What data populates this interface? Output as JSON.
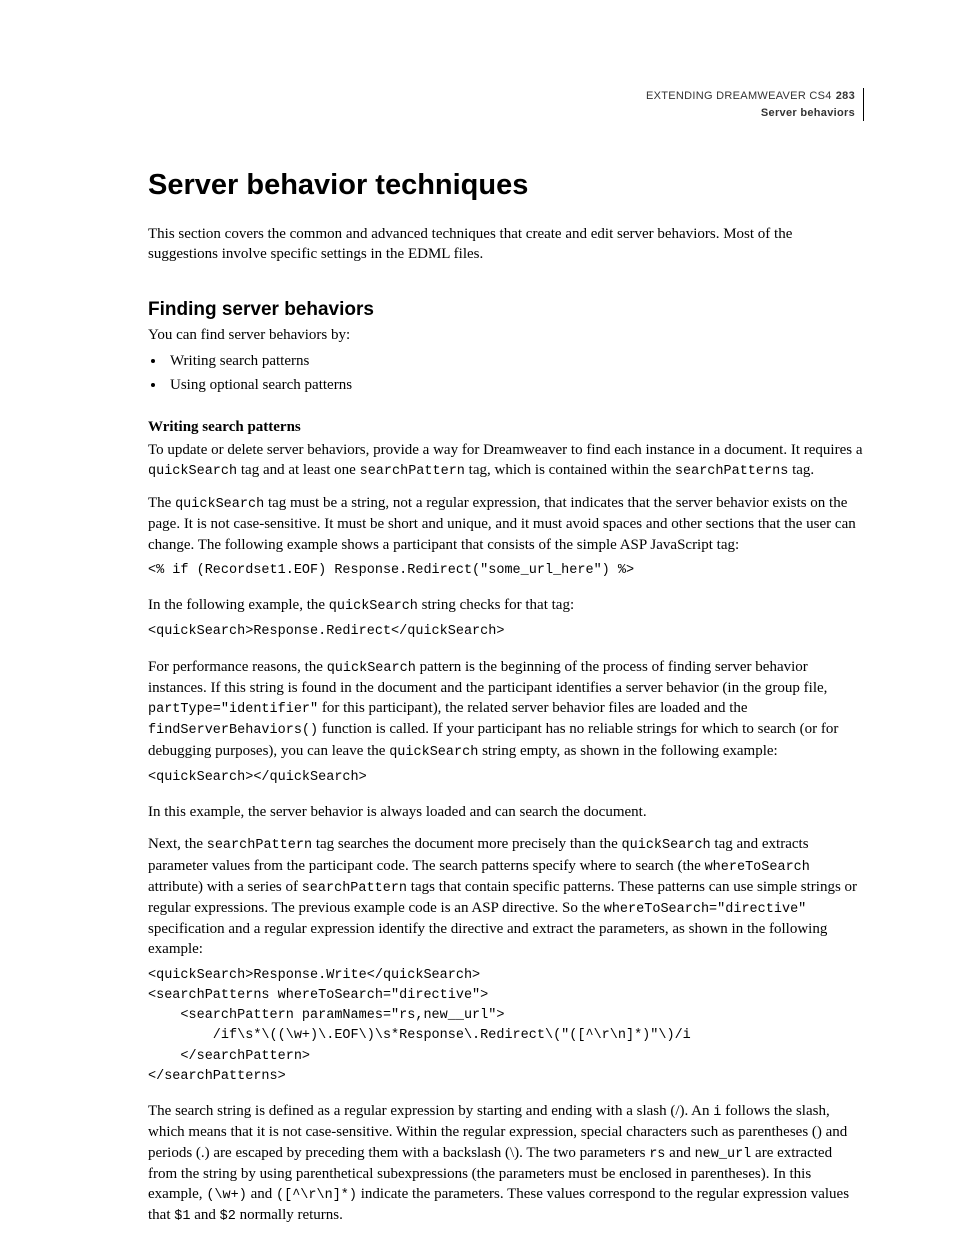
{
  "header": {
    "book": "EXTENDING DREAMWEAVER CS4",
    "page_number": "283",
    "section": "Server behaviors"
  },
  "h1": "Server behavior techniques",
  "intro": "This section covers the common and advanced techniques that create and edit server behaviors. Most of the suggestions involve specific settings in the EDML files.",
  "h2": "Finding server behaviors",
  "p_find_intro": "You can find server behaviors by:",
  "bullets": {
    "b1": "Writing search patterns",
    "b2": "Using optional search patterns"
  },
  "h3": "Writing search patterns",
  "p1a": "To update or delete server behaviors, provide a way for Dreamweaver to find each instance in a document. It requires a ",
  "c1a": "quickSearch",
  "p1b": " tag and at least one ",
  "c1b": "searchPattern",
  "p1c": " tag, which is contained within the ",
  "c1c": "searchPatterns",
  "p1d": " tag.",
  "p2a": "The ",
  "c2a": "quickSearch",
  "p2b": " tag must be a string, not a regular expression, that indicates that the server behavior exists on the page. It is not case-sensitive. It must be short and unique, and it must avoid spaces and other sections that the user can change. The following example shows a participant that consists of the simple ASP JavaScript tag:",
  "code1": "<% if (Recordset1.EOF) Response.Redirect(\"some_url_here\") %>",
  "p3a": "In the following example, the ",
  "c3a": "quickSearch",
  "p3b": " string checks for that tag:",
  "code2": "<quickSearch>Response.Redirect</quickSearch>",
  "p4a": "For performance reasons, the ",
  "c4a": "quickSearch",
  "p4b": " pattern is the beginning of the process of finding server behavior instances. If this string is found in the document and the participant identifies a server behavior (in the group file, ",
  "c4b": "partType=\"identifier\"",
  "p4c": " for this participant), the related server behavior files are loaded and the ",
  "c4c": "findServerBehaviors()",
  "p4d": " function is called. If your participant has no reliable strings for which to search (or for debugging purposes), you can leave the ",
  "c4d": "quickSearch",
  "p4e": " string empty, as shown in the following example:",
  "code3": "<quickSearch></quickSearch>",
  "p5": "In this example, the server behavior is always loaded and can search the document.",
  "p6a": "Next, the ",
  "c6a": "searchPattern",
  "p6b": " tag searches the document more precisely than the ",
  "c6b": "quickSearch",
  "p6c": "  tag and extracts parameter values from the participant code. The search patterns specify where to search (the ",
  "c6c": "whereToSearch",
  "p6d": " attribute) with a series of ",
  "c6d": "searchPattern",
  "p6e": " tags that contain specific patterns. These patterns can use simple strings or regular expressions. The previous example code is an ASP directive. So the ",
  "c6e": "whereToSearch=\"directive\"",
  "p6f": " specification and a regular expression identify the directive and extract the parameters, as shown in the following example:",
  "code4": "<quickSearch>Response.Write</quickSearch>\n<searchPatterns whereToSearch=\"directive\">\n    <searchPattern paramNames=\"rs,new__url\">\n        /if\\s*\\((\\w+)\\.EOF\\)\\s*Response\\.Redirect\\(\"([^\\r\\n]*)\"\\)/i\n    </searchPattern>\n</searchPatterns>",
  "p7a": "The search string is defined as a regular expression by starting and ending with a slash (/). An ",
  "c7a": "i",
  "p7b": " follows the slash, which means that it is not case-sensitive. Within the regular expression, special characters such as parentheses () and periods (.) are escaped by preceding them with a backslash (\\). The two parameters ",
  "c7b": "rs",
  "p7c": " and ",
  "c7c": "new_url",
  "p7d": " are extracted from the string by using parenthetical subexpressions (the parameters must be enclosed in parentheses). In this example, ",
  "c7d": "(\\w+)",
  "p7e": " and ",
  "c7e": "([^\\r\\n]*)",
  "p7f": " indicate the parameters. These values correspond to the regular expression values that ",
  "c7f": "$1",
  "p7g": " and ",
  "c7g": "$2",
  "p7h": " normally returns."
}
